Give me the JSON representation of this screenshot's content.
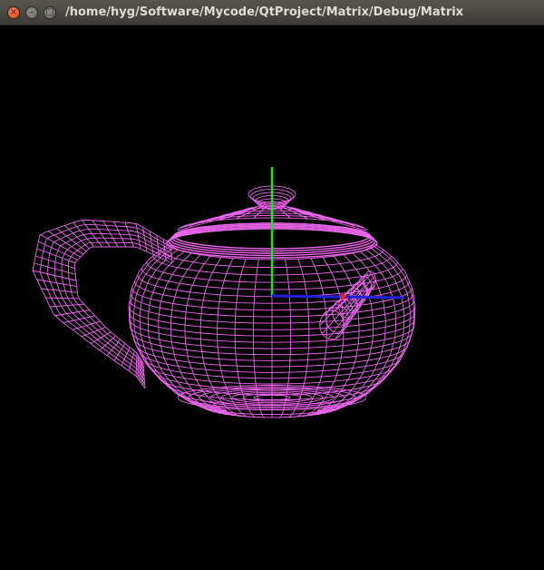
{
  "window": {
    "title": "/home/hyg/Software/Mycode/QtProject/Matrix/Debug/Matrix",
    "buttons": {
      "close_glyph": "×",
      "minimize_glyph": "–",
      "maximize_glyph": "□"
    }
  },
  "scene": {
    "background_color": "#000000",
    "mesh_color": "#ee66ee",
    "axis_y_color": "#22dd22",
    "axis_x_color": "#2222dd",
    "origin_marker_color": "#ee2222",
    "object_icon": "teapot-wireframe"
  }
}
